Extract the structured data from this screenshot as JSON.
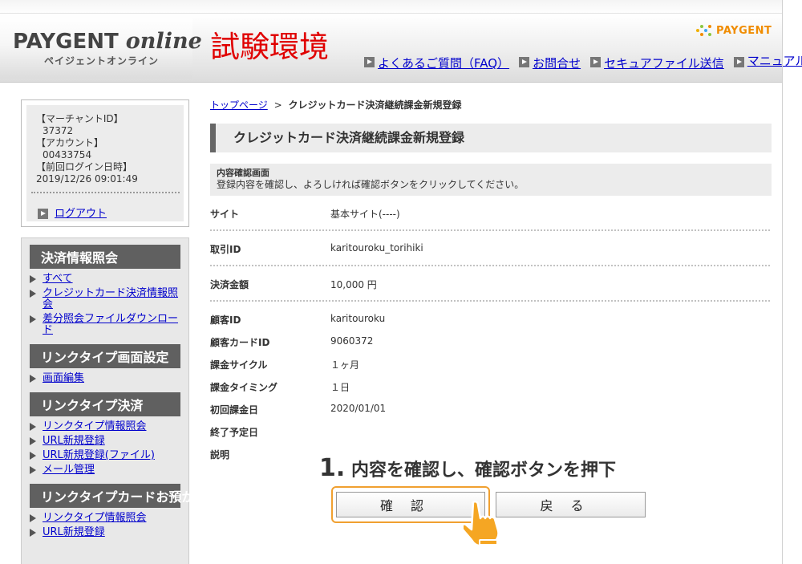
{
  "header": {
    "logo_main": "PAYGENT",
    "logo_online": "online",
    "logo_sub": "ペイジェントオンライン",
    "env_title": "試験環境",
    "brand": "PAYGENT",
    "nav": [
      {
        "label": "よくあるご質問（FAQ）"
      },
      {
        "label": "お問合せ"
      },
      {
        "label": "セキュアファイル送信"
      },
      {
        "label": "マニュアル"
      }
    ]
  },
  "login": {
    "merchant_id_label": "【マーチャントID】",
    "merchant_id": "37372",
    "account_label": "【アカウント】",
    "account": "00433754",
    "last_login_label": "【前回ログイン日時】",
    "last_login": "2019/12/26 09:01:49",
    "logout_label": "ログアウト"
  },
  "sidebar": {
    "groups": [
      {
        "heading": "決済情報照会",
        "items": [
          "すべて",
          "クレジットカード決済情報照会",
          "差分照会ファイルダウンロード"
        ]
      },
      {
        "heading": "リンクタイプ画面設定",
        "items": [
          "画面編集"
        ]
      },
      {
        "heading": "リンクタイプ決済",
        "items": [
          "リンクタイプ情報照会",
          "URL新規登録",
          "URL新規登録(ファイル)",
          "メール管理"
        ]
      },
      {
        "heading": "リンクタイプカードお預かり",
        "items": [
          "リンクタイプ情報照会",
          "URL新規登録"
        ]
      }
    ]
  },
  "breadcrumb": {
    "top": "トップページ",
    "sep": ">",
    "current": "クレジットカード決済継続課金新規登録"
  },
  "page_title": "クレジットカード決済継続課金新規登録",
  "confirm": {
    "title": "内容確認画面",
    "desc": "登録内容を確認し、よろしければ確認ボタンをクリックしてください。"
  },
  "fields": [
    {
      "label": "サイト",
      "value": "基本サイト(----)"
    },
    {
      "label": "取引ID",
      "value": "karitouroku_torihiki"
    },
    {
      "label": "決済金額",
      "value": "10,000 円"
    },
    {
      "label": "顧客ID",
      "value": "karitouroku"
    },
    {
      "label": "顧客カードID",
      "value": "9060372"
    },
    {
      "label": "課金サイクル",
      "value": "１ヶ月"
    },
    {
      "label": "課金タイミング",
      "value": "１日"
    },
    {
      "label": "初回課金日",
      "value": "2020/01/01"
    },
    {
      "label": "終了予定日",
      "value": ""
    },
    {
      "label": "説明",
      "value": ""
    }
  ],
  "step_note": {
    "num": "1.",
    "text": "内容を確認し、確認ボタンを押下"
  },
  "buttons": {
    "confirm": "確認",
    "back": "戻る"
  },
  "colors": {
    "env_title": "#e00000",
    "brand": "#f08c00",
    "link": "#0000cc",
    "menu_heading_bg": "#606060",
    "highlight": "#f0a030"
  }
}
